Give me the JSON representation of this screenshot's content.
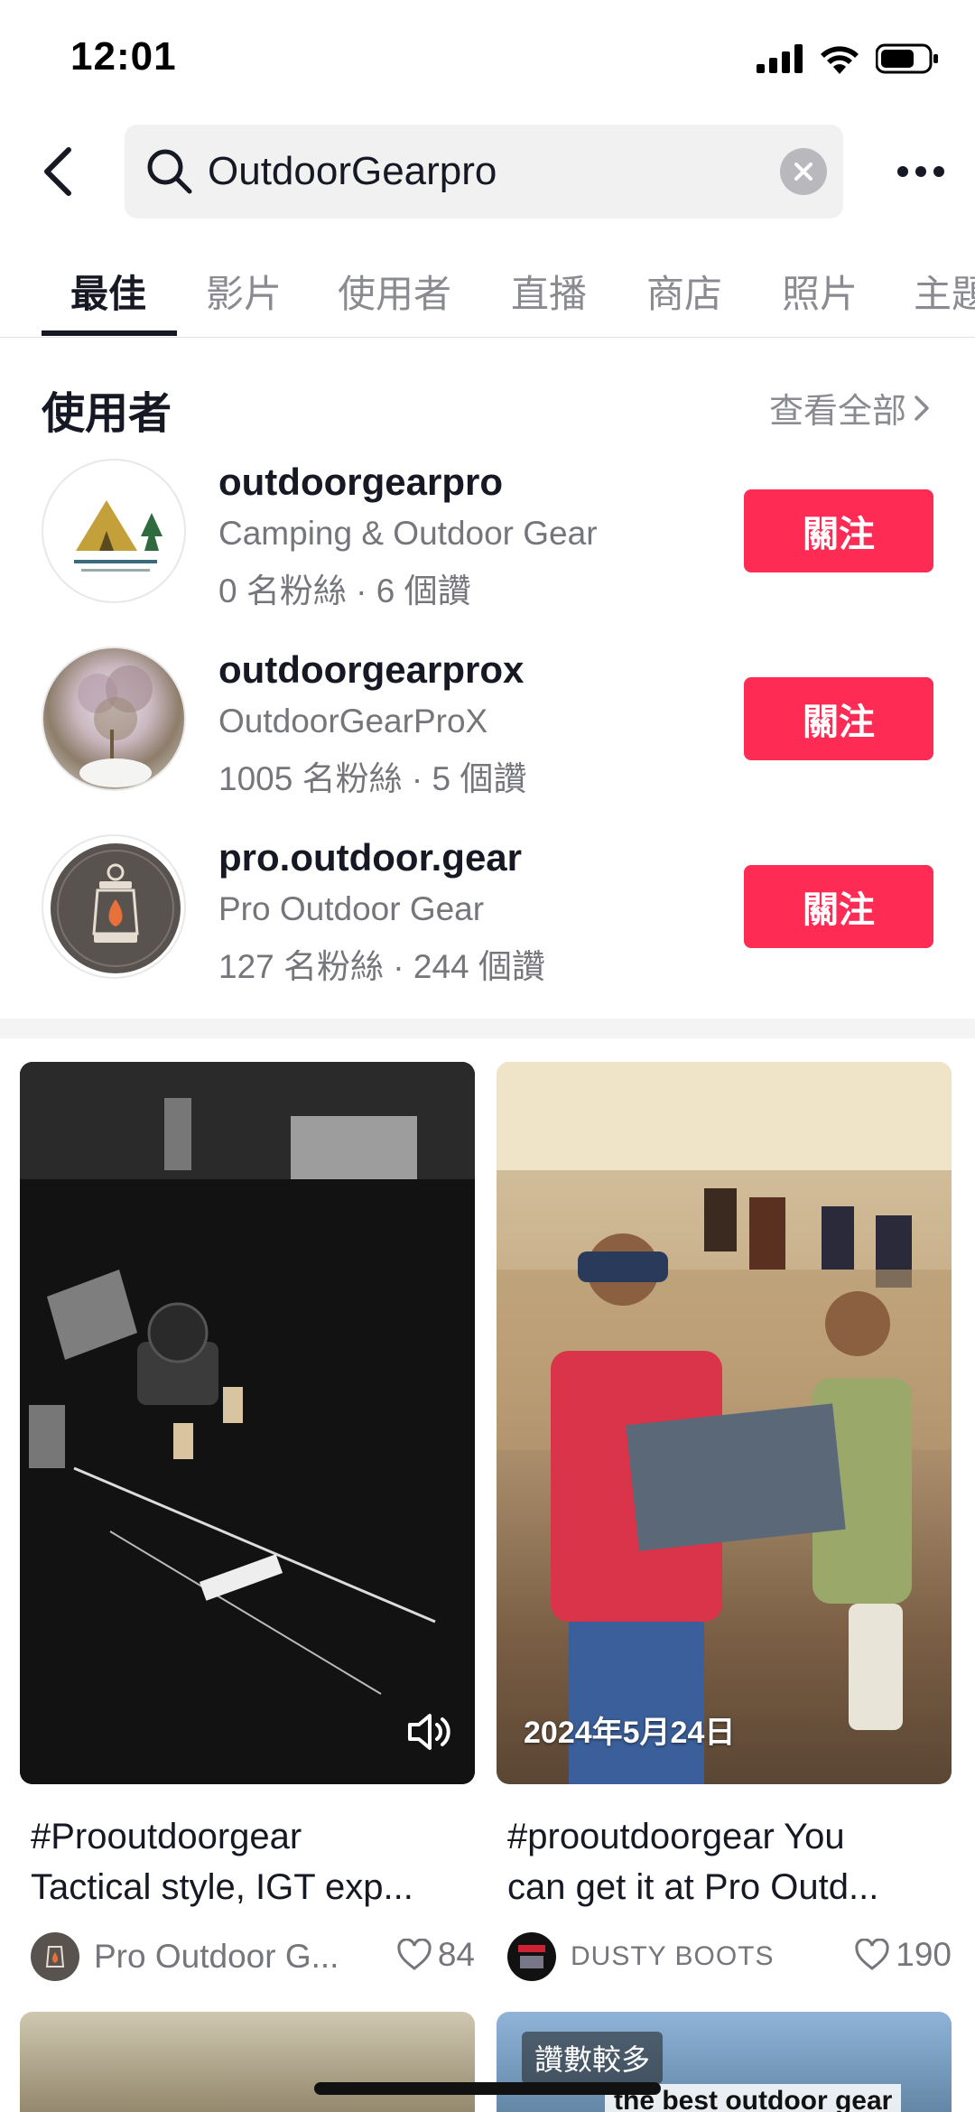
{
  "status": {
    "time": "12:01"
  },
  "search": {
    "query": "OutdoorGearpro"
  },
  "tabs": [
    "最佳",
    "影片",
    "使用者",
    "直播",
    "商店",
    "照片",
    "主題"
  ],
  "users_section": {
    "title": "使用者",
    "see_all": "查看全部"
  },
  "users": [
    {
      "username": "outdoorgearpro",
      "display_name": "Camping & Outdoor Gear",
      "stats": "0 名粉絲 · 6 個讚",
      "follow_label": "關注"
    },
    {
      "username": "outdoorgearprox",
      "display_name": "OutdoorGearProX",
      "stats": "1005 名粉絲 · 5 個讚",
      "follow_label": "關注"
    },
    {
      "username": "pro.outdoor.gear",
      "display_name": "Pro Outdoor Gear",
      "stats": "127 名粉絲 · 244 個讚",
      "follow_label": "關注"
    }
  ],
  "videos": [
    {
      "caption_line1": "#Prooutdoorgear",
      "caption_line2": "Tactical style, IGT exp...",
      "author": "Pro Outdoor G...",
      "likes": "84",
      "date_overlay": ""
    },
    {
      "caption_line1": "#prooutdoorgear  You",
      "caption_line2": "can get it at Pro Outd...",
      "author": "DUSTY BOOTS",
      "likes": "190",
      "date_overlay": "2024年5月24日"
    }
  ],
  "bottom_cards": {
    "badge": "讚數較多",
    "overlay_text": "the best outdoor gear"
  },
  "colors": {
    "accent": "#fe2c55",
    "text": "#161823",
    "secondary": "#8a8b91"
  }
}
